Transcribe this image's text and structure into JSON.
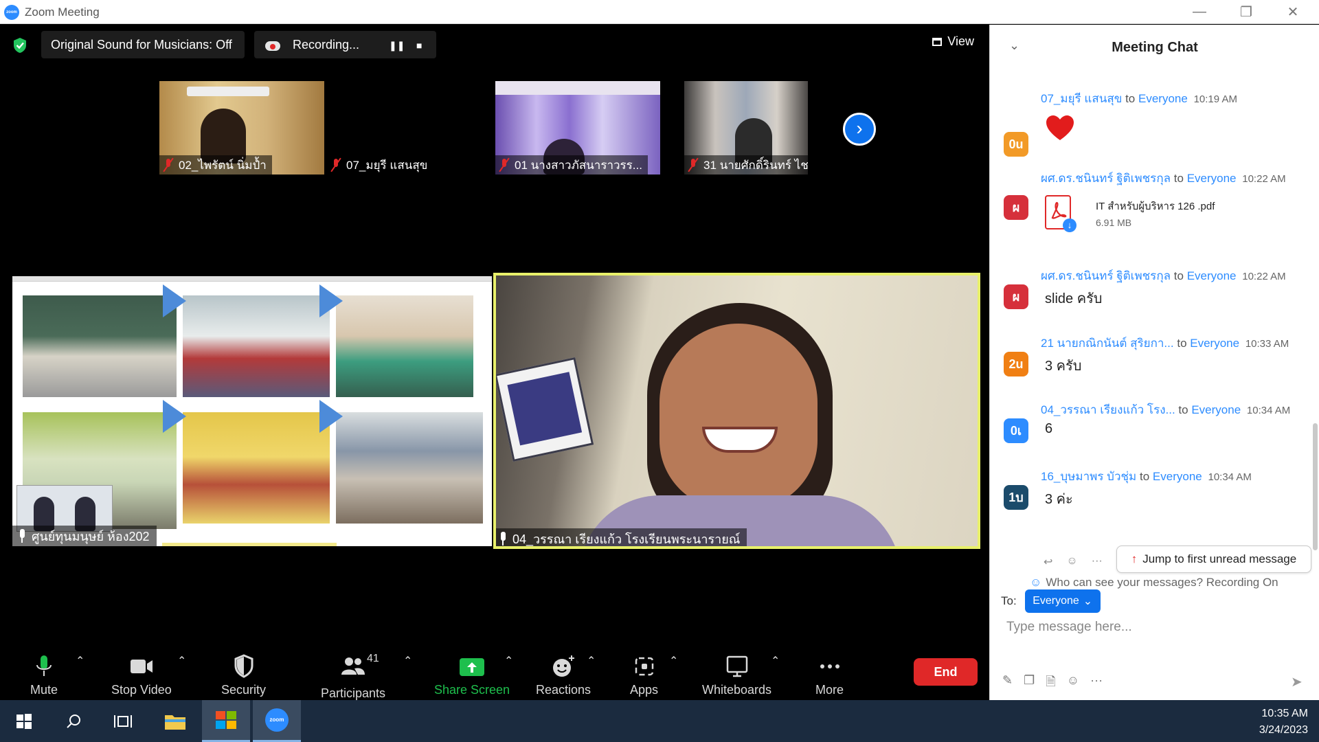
{
  "window": {
    "title": "Zoom Meeting",
    "logo_text": "zoom"
  },
  "top_bar": {
    "original_sound": "Original Sound for Musicians: Off",
    "recording": "Recording...",
    "view": "View"
  },
  "thumbnails": [
    {
      "name": "02_ไพรัตน์ นิ่มป้ำ"
    },
    {
      "name": "07_มยุรี แสนสุข"
    },
    {
      "name": "01 นางสาวภัสนาราวรร..."
    },
    {
      "name": "31 นายศักดิ์รินทร์ ไชติ..."
    }
  ],
  "main_tiles": {
    "left_label": "ศูนย์ทุนมนุษย์ ห้อง202",
    "right_label": "04_วรรณา เรียงแก้ว โรงเรียนพระนารายณ์"
  },
  "toolbar": {
    "mute": "Mute",
    "stop_video": "Stop Video",
    "security": "Security",
    "participants": "Participants",
    "participants_count": "41",
    "share_screen": "Share Screen",
    "reactions": "Reactions",
    "apps": "Apps",
    "whiteboards": "Whiteboards",
    "more": "More",
    "end": "End"
  },
  "chat": {
    "title": "Meeting Chat",
    "messages": [
      {
        "avatar": "0u",
        "avatar_color": "#f29a27",
        "sender": "07_มยุรี แสนสุข",
        "to": "to",
        "audience": "Everyone",
        "time": "10:19 AM",
        "kind": "heart"
      },
      {
        "avatar": "ผ",
        "avatar_color": "#d6303b",
        "sender": "ผศ.ดร.ชนินทร์ ฐิติเพชรกุล",
        "to": "to",
        "audience": "Everyone",
        "time": "10:22 AM",
        "kind": "file",
        "file_name": "IT สำหรับผู้บริหาร 126 .pdf",
        "file_size": "6.91 MB"
      },
      {
        "avatar": "ผ",
        "avatar_color": "#d6303b",
        "sender": "ผศ.ดร.ชนินทร์ ฐิติเพชรกุล",
        "to": "to",
        "audience": "Everyone",
        "time": "10:22 AM",
        "kind": "text",
        "text": "slide ครับ"
      },
      {
        "avatar": "2u",
        "avatar_color": "#f07f13",
        "sender": "21 นายกณิกนันต์ สุริยกา...",
        "to": "to",
        "audience": "Everyone",
        "time": "10:33 AM",
        "kind": "text",
        "text": "3 ครับ"
      },
      {
        "avatar": "0เ",
        "avatar_color": "#2d8cff",
        "sender": "04_วรรณา เรียงแก้ว โรง...",
        "to": "to",
        "audience": "Everyone",
        "time": "10:34 AM",
        "kind": "text",
        "text": "6"
      },
      {
        "avatar": "1บ",
        "avatar_color": "#1b4b6b",
        "sender": "16_บุษมาพร บัวชุ่ม",
        "to": "to",
        "audience": "Everyone",
        "time": "10:34 AM",
        "kind": "text",
        "text": "3 ค่ะ"
      }
    ],
    "jump_button": "Jump to first unread message",
    "privacy": "Who can see your messages? Recording On",
    "to_label": "To:",
    "to_value": "Everyone",
    "input_placeholder": "Type message here..."
  },
  "taskbar": {
    "time": "10:35 AM",
    "date": "3/24/2023"
  }
}
